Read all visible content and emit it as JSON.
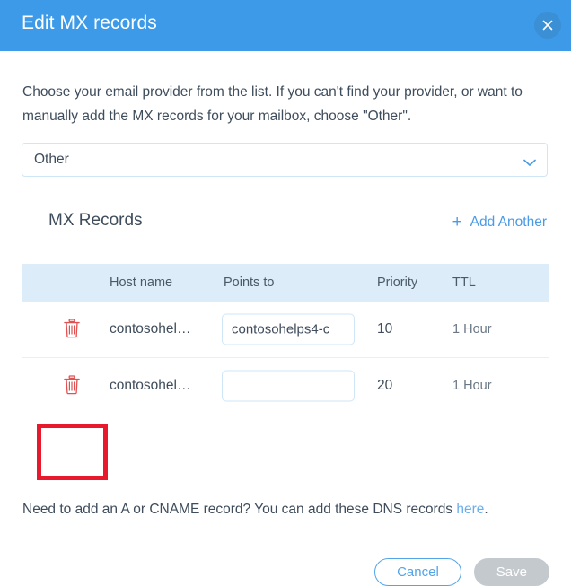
{
  "header": {
    "title": "Edit MX records",
    "close_icon": "close-icon"
  },
  "body": {
    "intro_text": "Choose your email provider from the list. If you can't find your provider, or want to manually add the MX records for your mailbox, choose \"Other\".",
    "provider_select": {
      "value": "Other",
      "chevron_icon": "chevron-down-icon"
    }
  },
  "records": {
    "section_title": "MX Records",
    "add_another_label": "Add Another",
    "add_another_icon": "plus-icon",
    "columns": [
      "Host name",
      "Points to",
      "Priority",
      "TTL"
    ],
    "rows": [
      {
        "delete_icon": "trash-icon",
        "host_name": "contosohel…",
        "points_to": "contosohelps4-c",
        "points_to_placeholder": "",
        "priority": "10",
        "ttl": "1 Hour",
        "highlighted": false
      },
      {
        "delete_icon": "trash-icon",
        "host_name": "contosohel…",
        "points_to": "",
        "points_to_placeholder": "",
        "priority": "20",
        "ttl": "1 Hour",
        "highlighted": true
      }
    ]
  },
  "dns_note": {
    "text_before": "Need to add an A or CNAME record? You can add these DNS records ",
    "link_text": "here",
    "text_after": "."
  },
  "footer": {
    "cancel_label": "Cancel",
    "save_label": "Save"
  },
  "colors": {
    "header_blue": "#3d9ae8",
    "accent_blue": "#4a9ae4",
    "table_head_blue": "#dcecf8",
    "trash_red": "#e05252",
    "annotation_red": "#e8192c",
    "save_disabled_gray": "#c4c9ce"
  }
}
